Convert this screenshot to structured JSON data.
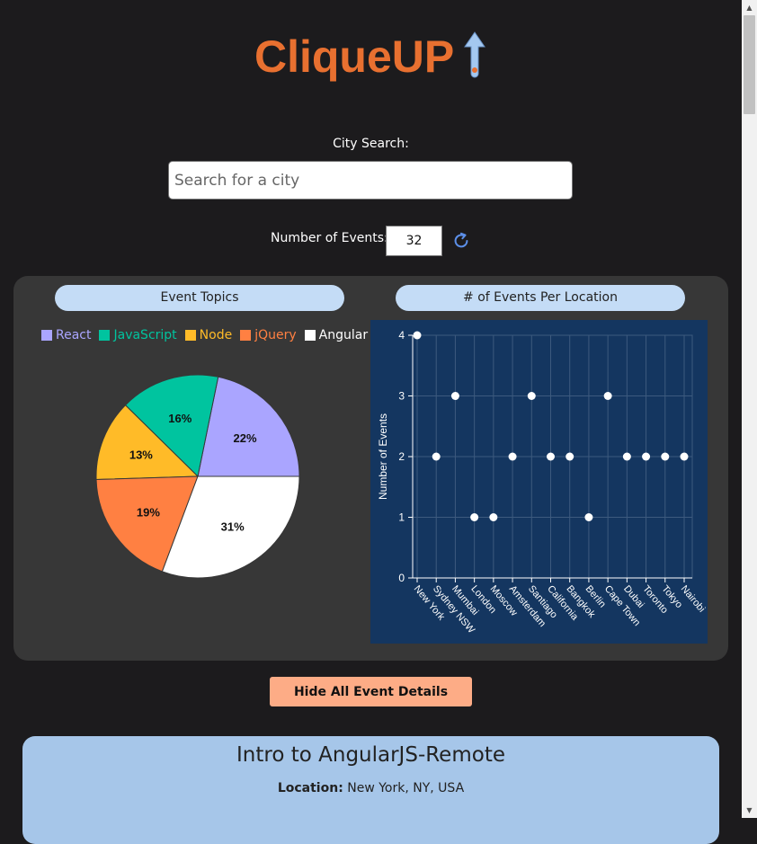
{
  "logo": {
    "text": "CliqueUP"
  },
  "search": {
    "label": "City Search:",
    "placeholder": "Search for a city"
  },
  "events_control": {
    "label": "Number of Events:",
    "value": "32"
  },
  "topics_chart": {
    "title": "Event Topics",
    "legend": [
      {
        "label": "React",
        "color": "#aaa5ff"
      },
      {
        "label": "JavaScript",
        "color": "#00c49f"
      },
      {
        "label": "Node",
        "color": "#ffbb28"
      },
      {
        "label": "jQuery",
        "color": "#ff8042"
      },
      {
        "label": "Angular",
        "color": "#ffffff"
      }
    ]
  },
  "location_chart": {
    "title": "# of Events Per Location"
  },
  "chart_data": [
    {
      "type": "pie",
      "title": "Event Topics",
      "labels": [
        "React",
        "JavaScript",
        "Node",
        "jQuery",
        "Angular"
      ],
      "values": [
        22,
        16,
        13,
        19,
        31
      ],
      "unit": "%",
      "colors": [
        "#aaa5ff",
        "#00c49f",
        "#ffbb28",
        "#ff8042",
        "#ffffff"
      ],
      "legend": "top"
    },
    {
      "type": "scatter",
      "title": "# of Events Per Location",
      "ylabel": "Number of Events",
      "xlabel": "",
      "categories": [
        "New York",
        "Sydney NSW",
        "Mumbai",
        "London",
        "Moscow",
        "Amsterdam",
        "Santiago",
        "California",
        "Bangkok",
        "Berlin",
        "Cape Town",
        "Dubai",
        "Toronto",
        "Tokyo",
        "Nairobi"
      ],
      "values": [
        4,
        2,
        3,
        1,
        1,
        2,
        3,
        2,
        2,
        1,
        3,
        2,
        2,
        2,
        2
      ],
      "ylim": [
        0,
        4
      ],
      "yticks": [
        0,
        1,
        2,
        3,
        4
      ],
      "grid": true
    }
  ],
  "actions": {
    "hide_details": "Hide All Event Details"
  },
  "event": {
    "title": "Intro to AngularJS-Remote",
    "location_label": "Location:",
    "location_value": "New York, NY, USA"
  }
}
